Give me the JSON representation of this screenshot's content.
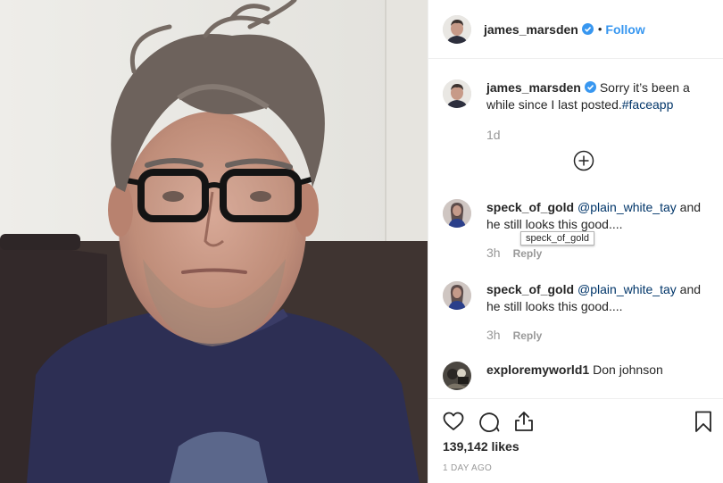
{
  "post": {
    "author": "james_marsden",
    "verified": true,
    "separator": "•",
    "follow_label": "Follow"
  },
  "caption": {
    "username": "james_marsden",
    "text": "Sorry it’s been a while since I last posted.",
    "hashtag": "#faceapp",
    "time": "1d"
  },
  "comments": [
    {
      "username": "speck_of_gold",
      "mention": "@plain_white_tay",
      "text": " and he still looks this good....",
      "time": "3h",
      "reply_label": "Reply",
      "tooltip": "speck_of_gold"
    },
    {
      "username": "speck_of_gold",
      "mention": "@plain_white_tay",
      "text": " and he still looks this good....",
      "time": "3h",
      "reply_label": "Reply"
    },
    {
      "username": "exploremyworld1",
      "text": "Don johnson"
    }
  ],
  "stats": {
    "likes": "139,142 likes",
    "posted_ago": "1 DAY AGO"
  },
  "icons": {
    "like": "heart-icon",
    "comment": "comment-bubble-icon",
    "share": "share-icon",
    "save": "bookmark-icon",
    "load_more": "plus-circle-icon",
    "verified": "verified-badge-icon"
  },
  "colors": {
    "link": "#3897f0",
    "mention": "#003569",
    "text": "#262626",
    "muted": "#999999",
    "verified": "#3897f0"
  }
}
